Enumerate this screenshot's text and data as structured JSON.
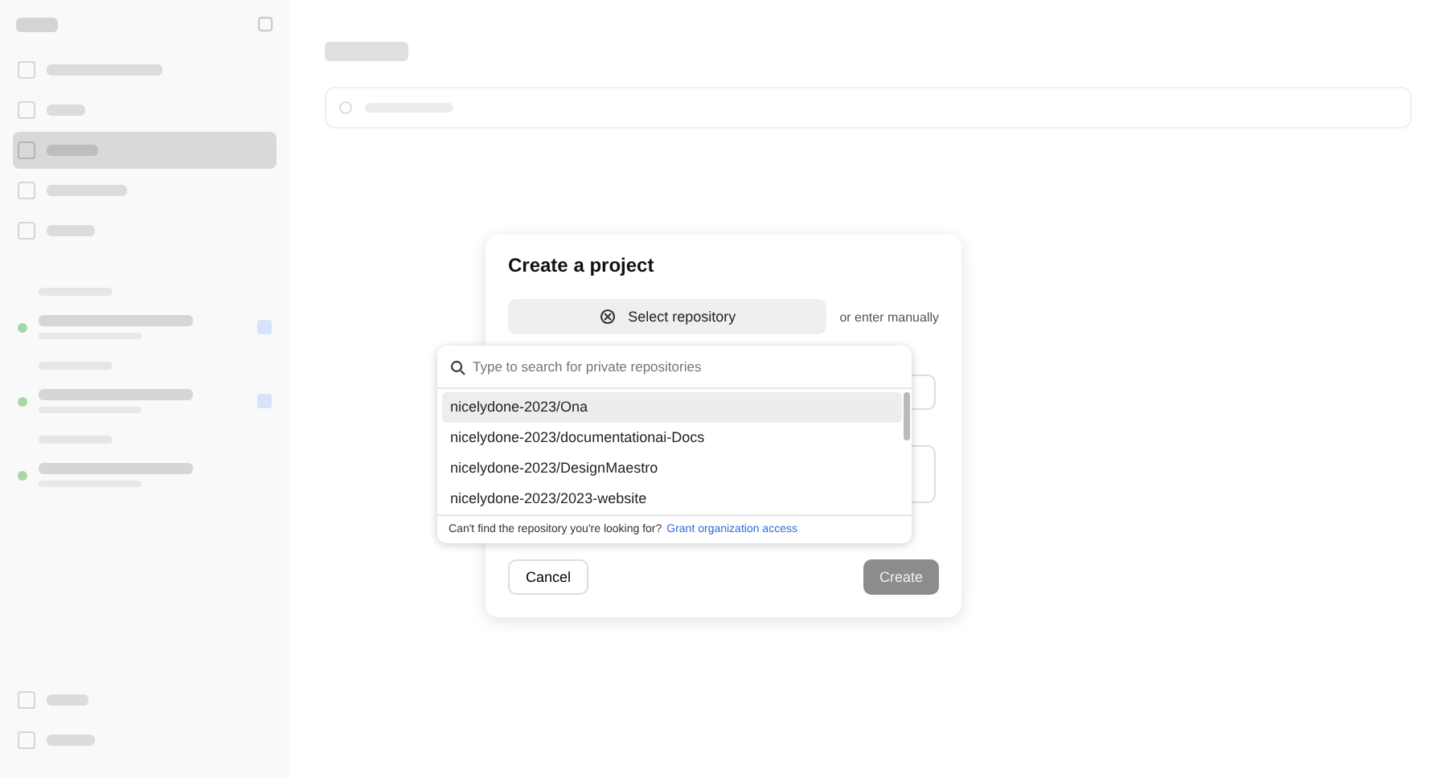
{
  "sidebar": {
    "items": [
      {
        "selected": false
      },
      {
        "selected": false
      },
      {
        "selected": true
      },
      {
        "selected": false
      },
      {
        "selected": false
      }
    ],
    "environments": [
      {
        "color": "#a6d8a6"
      },
      {
        "color": "#a6d8a6"
      },
      {
        "color": "#a6d8a6"
      }
    ]
  },
  "dialog": {
    "title": "Create a project",
    "select_button": "Select repository",
    "alt_text": "or enter manually",
    "cancel": "Cancel",
    "create": "Create",
    "create_disabled": true
  },
  "repo_dropdown": {
    "placeholder": "Type to search for private repositories",
    "items": [
      {
        "label": "nicelydone-2023/Ona",
        "selected": true
      },
      {
        "label": "nicelydone-2023/documentationai-Docs",
        "selected": false
      },
      {
        "label": "nicelydone-2023/DesignMaestro",
        "selected": false
      },
      {
        "label": "nicelydone-2023/2023-website",
        "selected": false
      }
    ],
    "footer_text": "Can't find the repository you're looking for?",
    "footer_link": "Grant organization access"
  }
}
